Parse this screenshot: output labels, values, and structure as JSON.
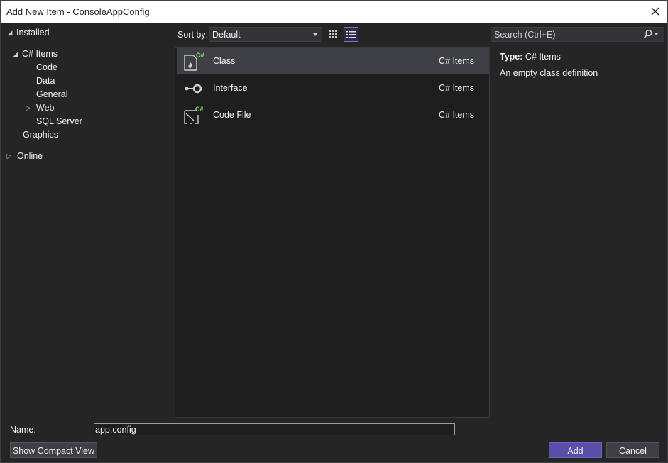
{
  "window": {
    "title": "Add New Item - ConsoleAppConfig"
  },
  "tree": {
    "installed": "Installed",
    "csharp_items": "C# Items",
    "code": "Code",
    "data": "Data",
    "general": "General",
    "web": "Web",
    "sql_server": "SQL Server",
    "graphics": "Graphics",
    "online": "Online"
  },
  "toolbar": {
    "sort_label": "Sort by:",
    "sort_value": "Default"
  },
  "search": {
    "placeholder": "Search (Ctrl+E)"
  },
  "templates": [
    {
      "name": "Class",
      "category": "C# Items",
      "icon": "class-icon"
    },
    {
      "name": "Interface",
      "category": "C# Items",
      "icon": "interface-icon"
    },
    {
      "name": "Code File",
      "category": "C# Items",
      "icon": "code-file-icon"
    }
  ],
  "details": {
    "type_label": "Type:",
    "type_value": "C# Items",
    "description": "An empty class definition"
  },
  "footer": {
    "name_label": "Name:",
    "name_value": "app.config",
    "compact_view": "Show Compact View",
    "add": "Add",
    "cancel": "Cancel"
  },
  "colors": {
    "accent": "#5a4fa8",
    "csharp_badge": "#8ee06b",
    "background": "#252526",
    "list_background": "#1e1e1e"
  }
}
